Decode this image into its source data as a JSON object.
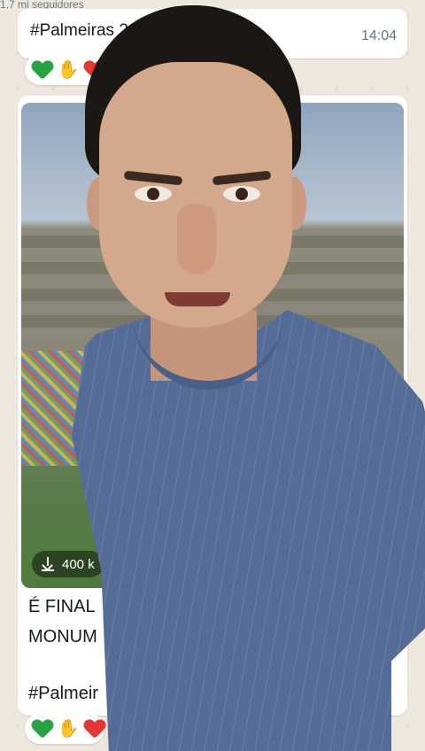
{
  "channel_header": "1,7 mi seguidores",
  "message1": {
    "text": "#Palmeiras 2025 de 2025",
    "time": "14:04"
  },
  "reactions": [
    "green-heart",
    "folded-hands",
    "red-heart"
  ],
  "message2": {
    "download_size": "400 k",
    "caption_line1": "É FINAL",
    "caption_line2": "MONUM",
    "hashtag": "#Palmeir"
  },
  "colors": {
    "chat_background": "#eee7de",
    "bubble": "#ffffff",
    "time_text": "#667781",
    "green_heart": "#27a244",
    "red_heart": "#e53535"
  }
}
